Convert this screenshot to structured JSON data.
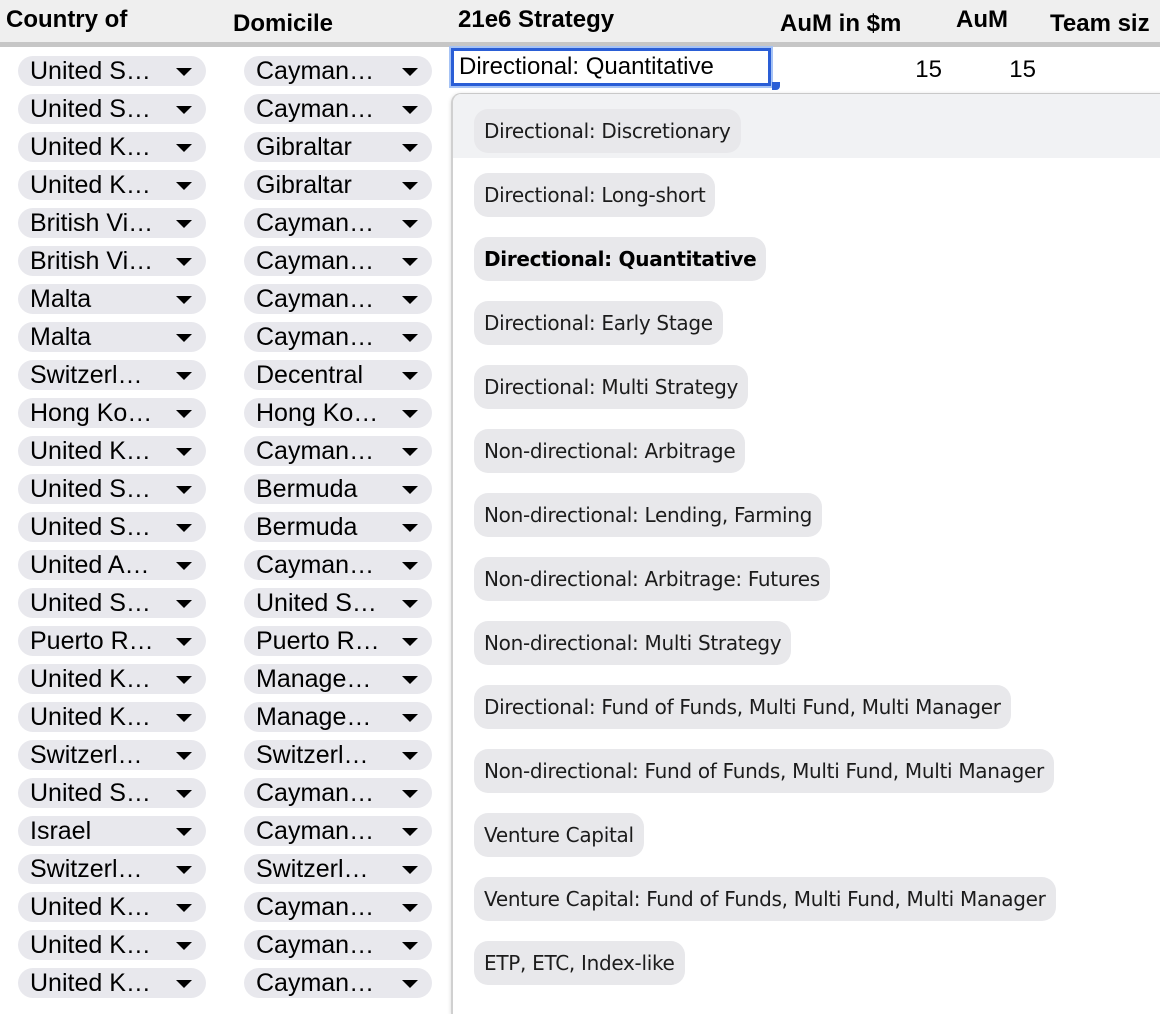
{
  "header": {
    "columns": [
      "Country of",
      "Domicile",
      "21e6 Strategy",
      "AuM in $m",
      "AuM",
      "Team siz"
    ]
  },
  "active_row": {
    "strategy_value": "Directional: Quantitative",
    "aum_m": "15",
    "aum": "15"
  },
  "rows": [
    {
      "country": "United S…",
      "domicile": "Cayman…"
    },
    {
      "country": "United S…",
      "domicile": "Cayman…"
    },
    {
      "country": "United K…",
      "domicile": "Gibraltar"
    },
    {
      "country": "United K…",
      "domicile": "Gibraltar"
    },
    {
      "country": "British Vi…",
      "domicile": "Cayman…"
    },
    {
      "country": "British Vi…",
      "domicile": "Cayman…"
    },
    {
      "country": "Malta",
      "domicile": "Cayman…"
    },
    {
      "country": "Malta",
      "domicile": "Cayman…"
    },
    {
      "country": "Switzerl…",
      "domicile": "Decentral"
    },
    {
      "country": "Hong Ko…",
      "domicile": "Hong Ko…"
    },
    {
      "country": "United K…",
      "domicile": "Cayman…"
    },
    {
      "country": "United S…",
      "domicile": "Bermuda"
    },
    {
      "country": "United S…",
      "domicile": "Bermuda"
    },
    {
      "country": "United A…",
      "domicile": "Cayman…"
    },
    {
      "country": "United S…",
      "domicile": "United S…"
    },
    {
      "country": "Puerto R…",
      "domicile": "Puerto R…"
    },
    {
      "country": "United K…",
      "domicile": "Manage…"
    },
    {
      "country": "United K…",
      "domicile": "Manage…"
    },
    {
      "country": "Switzerl…",
      "domicile": "Switzerl…"
    },
    {
      "country": "United S…",
      "domicile": "Cayman…"
    },
    {
      "country": "Israel",
      "domicile": "Cayman…"
    },
    {
      "country": "Switzerl…",
      "domicile": "Switzerl…"
    },
    {
      "country": "United K…",
      "domicile": "Cayman…"
    },
    {
      "country": "United K…",
      "domicile": "Cayman…"
    },
    {
      "country": "United K…",
      "domicile": "Cayman…"
    }
  ],
  "dropdown": {
    "highlighted_index": 0,
    "selected_index": 2,
    "options": [
      "Directional: Discretionary",
      "Directional: Long-short",
      "Directional: Quantitative",
      "Directional: Early Stage",
      "Directional: Multi Strategy",
      "Non-directional: Arbitrage",
      "Non-directional: Lending, Farming",
      "Non-directional: Arbitrage: Futures",
      "Non-directional: Multi Strategy",
      "Directional: Fund of Funds, Multi Fund, Multi Manager",
      "Non-directional: Fund of Funds, Multi Fund, Multi Manager",
      "Venture Capital",
      "Venture Capital: Fund of Funds, Multi Fund, Multi Manager",
      "ETP, ETC, Index-like"
    ]
  },
  "icons": {
    "chip_arrow": "chevron-down-icon"
  },
  "colors": {
    "selection_border": "#2a5ed6",
    "chip_bg": "#e8e8ed",
    "header_bg": "#efefef"
  }
}
